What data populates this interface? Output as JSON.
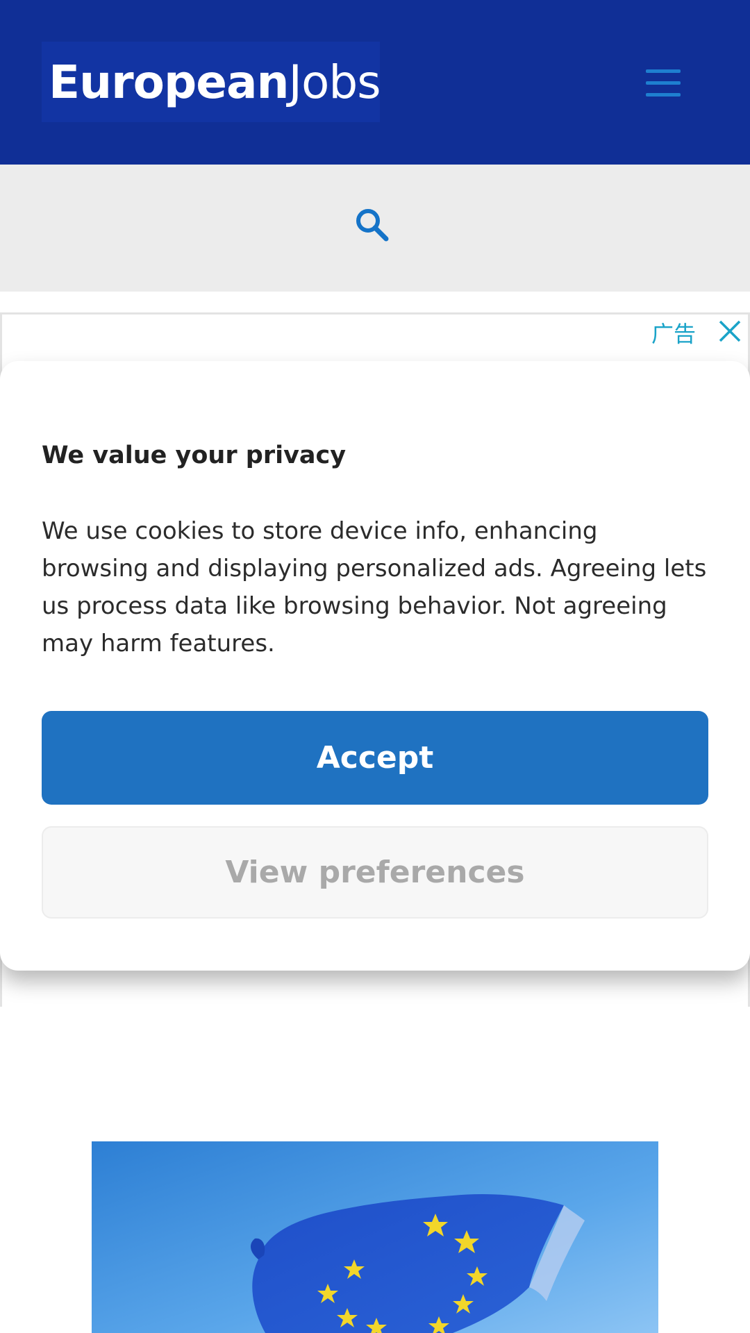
{
  "header": {
    "logo_part1": "European",
    "logo_part2": "Jobs",
    "colors": {
      "bar": "#102f96",
      "logo_bg": "#1234a3",
      "menu": "#1e7fd0"
    },
    "menu_icon": "hamburger-menu-icon"
  },
  "search": {
    "icon": "search-icon",
    "color": "#1473c8"
  },
  "ad": {
    "label": "广告",
    "close_icon": "close-icon"
  },
  "consent": {
    "title": "We value your privacy",
    "body": "We use cookies to store device info, enhancing browsing and displaying personalized ads. Agreeing lets us process data like browsing behavior. Not agreeing may harm features.",
    "accept_label": "Accept",
    "preferences_label": "View preferences",
    "colors": {
      "accept": "#1f72c1",
      "preferences_text": "#a9a9a9"
    }
  },
  "hero": {
    "image": "eu-flag-image"
  }
}
